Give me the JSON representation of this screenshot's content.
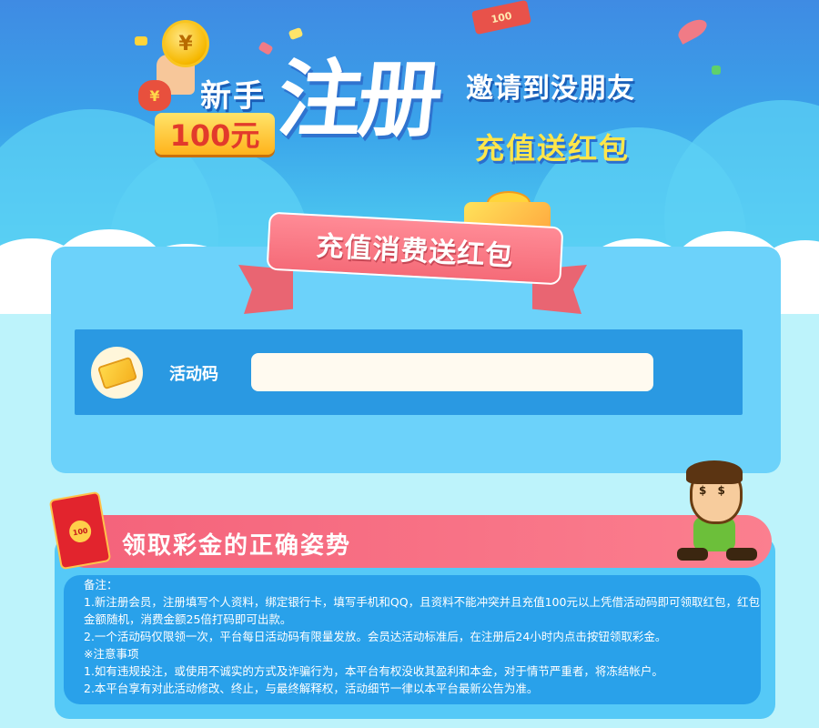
{
  "banner": {
    "newbie": "新手",
    "amount": "100元",
    "register": "注册",
    "invite": "邀请到没朋友",
    "recharge_gift": "充值送红包",
    "coin_symbol": "¥",
    "bill_text": "100"
  },
  "activity": {
    "ribbon_title": "充值消费送红包",
    "code_label": "活动码",
    "code_value": "",
    "code_placeholder": ""
  },
  "guide": {
    "title": "领取彩金的正确姿势",
    "envelope_badge": "100",
    "notes": [
      "备注：",
      "1.新注册会员，注册填写个人资料，绑定银行卡，填写手机和QQ，且资料不能冲突并且充值100元以上凭借活动码即可领取红包，红包金额随机，消费金额25倍打码即可出款。",
      "2.一个活动码仅限领一次，平台每日活动码有限量发放。会员达活动标准后，在注册后24小时内点击按钮领取彩金。",
      "※注意事项",
      "1.如有违规投注，或使用不诚实的方式及诈骗行为，本平台有权没收其盈利和本金，对于情节严重者，将冻结帐户。",
      "2.本平台享有对此活动修改、终止，与最终解释权，活动细节一律以本平台最新公告为准。"
    ]
  },
  "icons": {
    "coin": "coin-icon",
    "money_bag": "money-bag-icon",
    "ticket": "ticket-icon",
    "red_envelope": "red-envelope-icon",
    "mascot": "mascot-illustration"
  },
  "colors": {
    "banner_blue": "#3aa3ea",
    "panel_blue": "#6cd2fa",
    "row_blue": "#2a99e2",
    "ribbon_pink": "#f56b78",
    "title_pink": "#fb7f8f",
    "gold": "#ffe64a"
  }
}
